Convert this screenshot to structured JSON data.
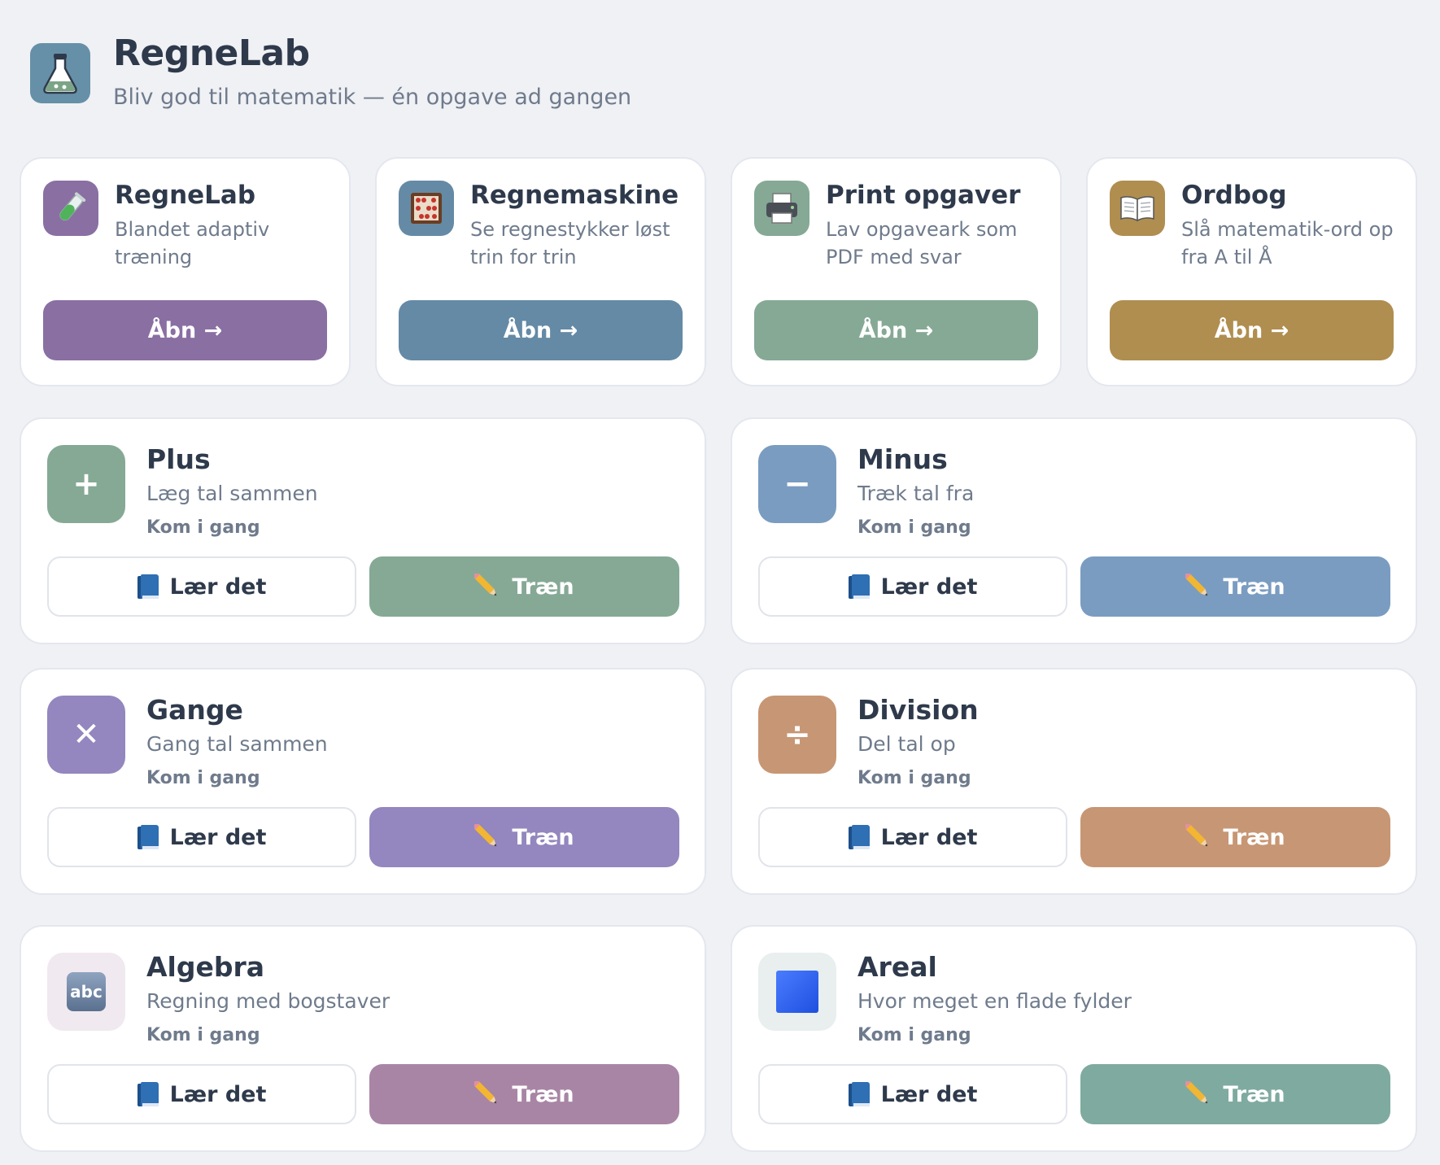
{
  "header": {
    "title": "RegneLab",
    "subtitle": "Bliv god til matematik — én opgave ad gangen",
    "logo_icon": "flask-icon",
    "logo_color": "#6690a8"
  },
  "tools": [
    {
      "id": "regnelab",
      "title": "RegneLab",
      "description": "Blandet adaptiv træning",
      "button": "Åbn →",
      "icon": "test-tube-icon",
      "color": "#8a6fa3",
      "icon_bg": "#8a6fa3"
    },
    {
      "id": "regnemaskine",
      "title": "Regnemaskine",
      "description": "Se regnestykker løst trin for trin",
      "button": "Åbn →",
      "icon": "abacus-icon",
      "color": "#648aa6",
      "icon_bg": "#648aa6"
    },
    {
      "id": "print",
      "title": "Print opgaver",
      "description": "Lav opgaveark som PDF med svar",
      "button": "Åbn →",
      "icon": "printer-icon",
      "color": "#85a995",
      "icon_bg": "#85a995"
    },
    {
      "id": "ordbog",
      "title": "Ordbog",
      "description": "Slå matematik-ord op fra A til Å",
      "button": "Åbn →",
      "icon": "open-book-icon",
      "color": "#b08e50",
      "icon_bg": "#b08e50"
    }
  ],
  "topics": [
    {
      "id": "plus",
      "title": "Plus",
      "description": "Læg tal sammen",
      "level": "Kom i gang",
      "symbol": "+",
      "learn": "Lær det",
      "train": "Træn",
      "color": "#85a995",
      "icon_bg": "#85a995",
      "icon": "plus-icon"
    },
    {
      "id": "minus",
      "title": "Minus",
      "description": "Træk tal fra",
      "level": "Kom i gang",
      "symbol": "−",
      "learn": "Lær det",
      "train": "Træn",
      "color": "#7a9cc1",
      "icon_bg": "#7a9cc1",
      "icon": "minus-icon"
    },
    {
      "id": "gange",
      "title": "Gange",
      "description": "Gang tal sammen",
      "level": "Kom i gang",
      "symbol": "✕",
      "learn": "Lær det",
      "train": "Træn",
      "color": "#9486be",
      "icon_bg": "#9486be",
      "icon": "multiply-icon"
    },
    {
      "id": "division",
      "title": "Division",
      "description": "Del tal op",
      "level": "Kom i gang",
      "symbol": "÷",
      "learn": "Lær det",
      "train": "Træn",
      "color": "#c79674",
      "icon_bg": "#c79674",
      "icon": "divide-icon"
    },
    {
      "id": "algebra",
      "title": "Algebra",
      "description": "Regning med bogstaver",
      "level": "Kom i gang",
      "symbol": "abc",
      "learn": "Lær det",
      "train": "Træn",
      "color": "#a885a5",
      "icon_bg": "#f0e9ef",
      "icon": "abc-icon"
    },
    {
      "id": "areal",
      "title": "Areal",
      "description": "Hvor meget en flade fylder",
      "level": "Kom i gang",
      "symbol": "",
      "learn": "Lær det",
      "train": "Træn",
      "color": "#7faaa0",
      "icon_bg": "#e8efee",
      "icon": "blue-square-icon"
    }
  ]
}
